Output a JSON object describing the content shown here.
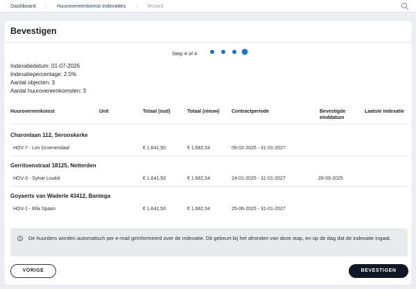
{
  "breadcrumb": [
    "Dashboard",
    "Huurovereenkomst indexaties",
    "Wizard"
  ],
  "card": {
    "title": "Bevestigen"
  },
  "wizard": {
    "step_label": "Step 4 of 4",
    "total_steps": 4,
    "current_step": 4
  },
  "summary": [
    "Indexatiedatum: 01-07-2026",
    "Indexatiepercentage: 2.5%",
    "Aantal objecten: 3",
    "Aantal huurovereenkomsten: 3"
  ],
  "table": {
    "headers": [
      "Huurovereenkomst",
      "Unit",
      "Totaal (oud)",
      "Totaal (nieuw)",
      "Contractperiode",
      "Bevestigde einddatum",
      "Laatste indexatie"
    ],
    "groups": [
      {
        "object": "Charonlaan 112, Serooskerke",
        "rows": [
          {
            "contract": "HOV-7 - Lex Groenendaal",
            "unit": "",
            "old": "€ 1.641,50",
            "new": "€ 1.682,54",
            "period": "09-02-2025 - 31-01-2027",
            "confirmed_end": "",
            "last_index": ""
          }
        ]
      },
      {
        "object": "Gerritsenstraat 18125, Netterden",
        "rows": [
          {
            "contract": "HOV-3 - Sylvie Loukili",
            "unit": "",
            "old": "€ 1.641,50",
            "new": "€ 1.682,54",
            "period": "24-01-2025 - 31-01-2027",
            "confirmed_end": "28-09-2025",
            "last_index": ""
          }
        ]
      },
      {
        "object": "Goyaerts van Waderle 43412, Bantega",
        "rows": [
          {
            "contract": "HOV-1 - Ella Spaan",
            "unit": "",
            "old": "€ 1.641,50",
            "new": "€ 1.682,54",
            "period": "25-06-2025 - 31-01-2027",
            "confirmed_end": "",
            "last_index": ""
          }
        ]
      }
    ]
  },
  "notice": {
    "icon": "info-icon",
    "text": "De huurders worden automatisch per e-mail geïnformeerd over de indexatie. Dit gebeurt bij het afronden van deze stap, en op de dag dat de indexatie ingaat."
  },
  "buttons": {
    "previous": "VORIGE",
    "confirm": "BEVESTIGEN"
  },
  "colors": {
    "accent": "#1f6fc3",
    "primary_button": "#0f1724",
    "notice_bg": "#e8eaed"
  }
}
